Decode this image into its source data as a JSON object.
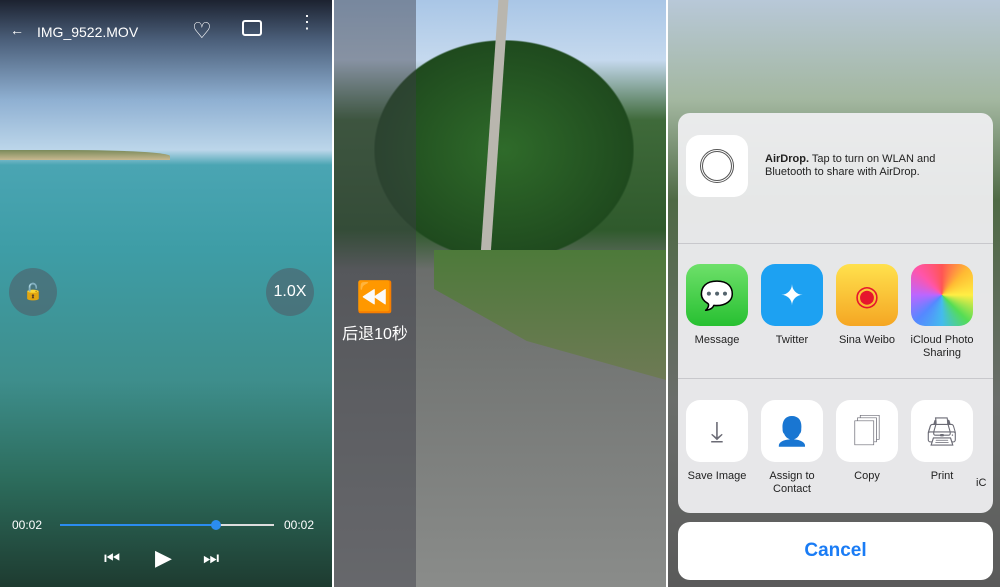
{
  "player": {
    "title": "IMG_9522.MOV",
    "speed": "1.0X",
    "current_time": "00:02",
    "total_time": "00:02",
    "progress_percent": 73,
    "accent": "#2b8cf0"
  },
  "rewind": {
    "label": "后退10秒"
  },
  "share": {
    "airdrop_title": "AirDrop.",
    "airdrop_text": " Tap to turn on WLAN and Bluetooth to share with AirDrop.",
    "apps": [
      {
        "label": "Message"
      },
      {
        "label": "Twitter"
      },
      {
        "label": "Sina Weibo"
      },
      {
        "label": "iCloud Photo Sharing"
      }
    ],
    "actions": [
      {
        "label": "Save Image"
      },
      {
        "label": "Assign to Contact"
      },
      {
        "label": "Copy"
      },
      {
        "label": "Print"
      },
      {
        "label": "iC"
      }
    ],
    "cancel": "Cancel"
  }
}
